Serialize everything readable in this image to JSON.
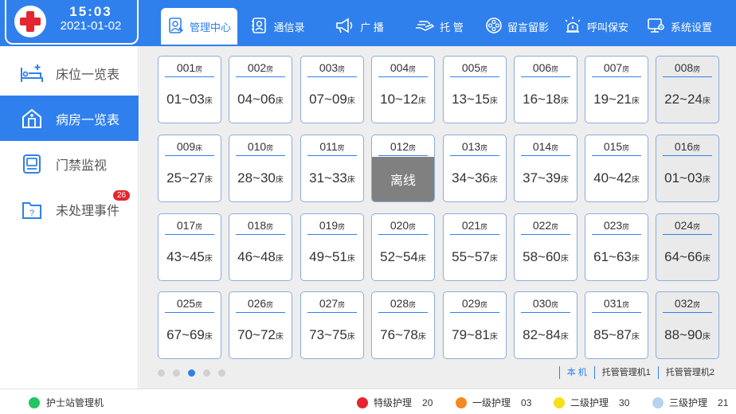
{
  "header": {
    "time": "15:03",
    "date": "2021-01-02",
    "tabs": [
      {
        "label": "管理中心",
        "icon": "nurse-doc-icon"
      },
      {
        "label": "通信录",
        "icon": "contacts-icon"
      },
      {
        "label": "广  播",
        "icon": "megaphone-icon"
      },
      {
        "label": "托  管",
        "icon": "handover-icon"
      },
      {
        "label": "留言留影",
        "icon": "film-reel-icon"
      },
      {
        "label": "呼叫保安",
        "icon": "alarm-light-icon"
      },
      {
        "label": "系统设置",
        "icon": "monitor-gear-icon"
      }
    ]
  },
  "sidebar": {
    "items": [
      {
        "label": "床位一览表",
        "icon": "bed-icon"
      },
      {
        "label": "病房一览表",
        "icon": "ward-house-icon"
      },
      {
        "label": "门禁监视",
        "icon": "access-monitor-icon"
      },
      {
        "label": "未处理事件",
        "icon": "pending-folder-icon",
        "badge": "26"
      }
    ]
  },
  "rooms": [
    {
      "num": "001",
      "unit": "房",
      "beds": "01~03",
      "bed_unit": "床"
    },
    {
      "num": "002",
      "unit": "房",
      "beds": "04~06",
      "bed_unit": "床"
    },
    {
      "num": "003",
      "unit": "房",
      "beds": "07~09",
      "bed_unit": "床"
    },
    {
      "num": "004",
      "unit": "房",
      "beds": "10~12",
      "bed_unit": "床"
    },
    {
      "num": "005",
      "unit": "房",
      "beds": "13~15",
      "bed_unit": "床"
    },
    {
      "num": "006",
      "unit": "房",
      "beds": "16~18",
      "bed_unit": "床"
    },
    {
      "num": "007",
      "unit": "房",
      "beds": "19~21",
      "bed_unit": "床"
    },
    {
      "num": "008",
      "unit": "房",
      "beds": "22~24",
      "bed_unit": "床",
      "gray": true
    },
    {
      "num": "009",
      "unit": "床",
      "beds": "25~27",
      "bed_unit": "床"
    },
    {
      "num": "010",
      "unit": "房",
      "beds": "28~30",
      "bed_unit": "床"
    },
    {
      "num": "011",
      "unit": "房",
      "beds": "31~33",
      "bed_unit": "床"
    },
    {
      "num": "012",
      "unit": "房",
      "offline": "离线"
    },
    {
      "num": "013",
      "unit": "房",
      "beds": "34~36",
      "bed_unit": "床"
    },
    {
      "num": "014",
      "unit": "房",
      "beds": "37~39",
      "bed_unit": "床"
    },
    {
      "num": "015",
      "unit": "房",
      "beds": "40~42",
      "bed_unit": "床"
    },
    {
      "num": "016",
      "unit": "房",
      "beds": "01~03",
      "bed_unit": "床",
      "gray": true
    },
    {
      "num": "017",
      "unit": "房",
      "beds": "43~45",
      "bed_unit": "床"
    },
    {
      "num": "018",
      "unit": "房",
      "beds": "46~48",
      "bed_unit": "床"
    },
    {
      "num": "019",
      "unit": "房",
      "beds": "49~51",
      "bed_unit": "床"
    },
    {
      "num": "020",
      "unit": "房",
      "beds": "52~54",
      "bed_unit": "床"
    },
    {
      "num": "021",
      "unit": "房",
      "beds": "55~57",
      "bed_unit": "床"
    },
    {
      "num": "022",
      "unit": "房",
      "beds": "58~60",
      "bed_unit": "床"
    },
    {
      "num": "023",
      "unit": "房",
      "beds": "61~63",
      "bed_unit": "床"
    },
    {
      "num": "024",
      "unit": "房",
      "beds": "64~66",
      "bed_unit": "床",
      "gray": true
    },
    {
      "num": "025",
      "unit": "房",
      "beds": "67~69",
      "bed_unit": "床"
    },
    {
      "num": "026",
      "unit": "房",
      "beds": "70~72",
      "bed_unit": "床"
    },
    {
      "num": "027",
      "unit": "房",
      "beds": "73~75",
      "bed_unit": "床"
    },
    {
      "num": "028",
      "unit": "房",
      "beds": "76~78",
      "bed_unit": "床"
    },
    {
      "num": "029",
      "unit": "房",
      "beds": "79~81",
      "bed_unit": "床"
    },
    {
      "num": "030",
      "unit": "房",
      "beds": "82~84",
      "bed_unit": "床"
    },
    {
      "num": "031",
      "unit": "房",
      "beds": "85~87",
      "bed_unit": "床"
    },
    {
      "num": "032",
      "unit": "房",
      "beds": "88~90",
      "bed_unit": "床",
      "gray": true
    }
  ],
  "pagination": {
    "pages": 5,
    "current": 3
  },
  "machines": [
    "本 机",
    "托管管理机1",
    "托管管理机2"
  ],
  "footer": {
    "station": "护士站管理机",
    "station_color": "#22c55e",
    "legend": [
      {
        "label": "特级护理",
        "count": "20",
        "color": "#e3262f"
      },
      {
        "label": "一级护理",
        "count": "03",
        "color": "#f5891f"
      },
      {
        "label": "二级护理",
        "count": "30",
        "color": "#f7e017"
      },
      {
        "label": "三级护理",
        "count": "21",
        "color": "#b5d3f0"
      }
    ]
  },
  "colors": {
    "primary": "#2f80ed",
    "offline": "#808080"
  }
}
